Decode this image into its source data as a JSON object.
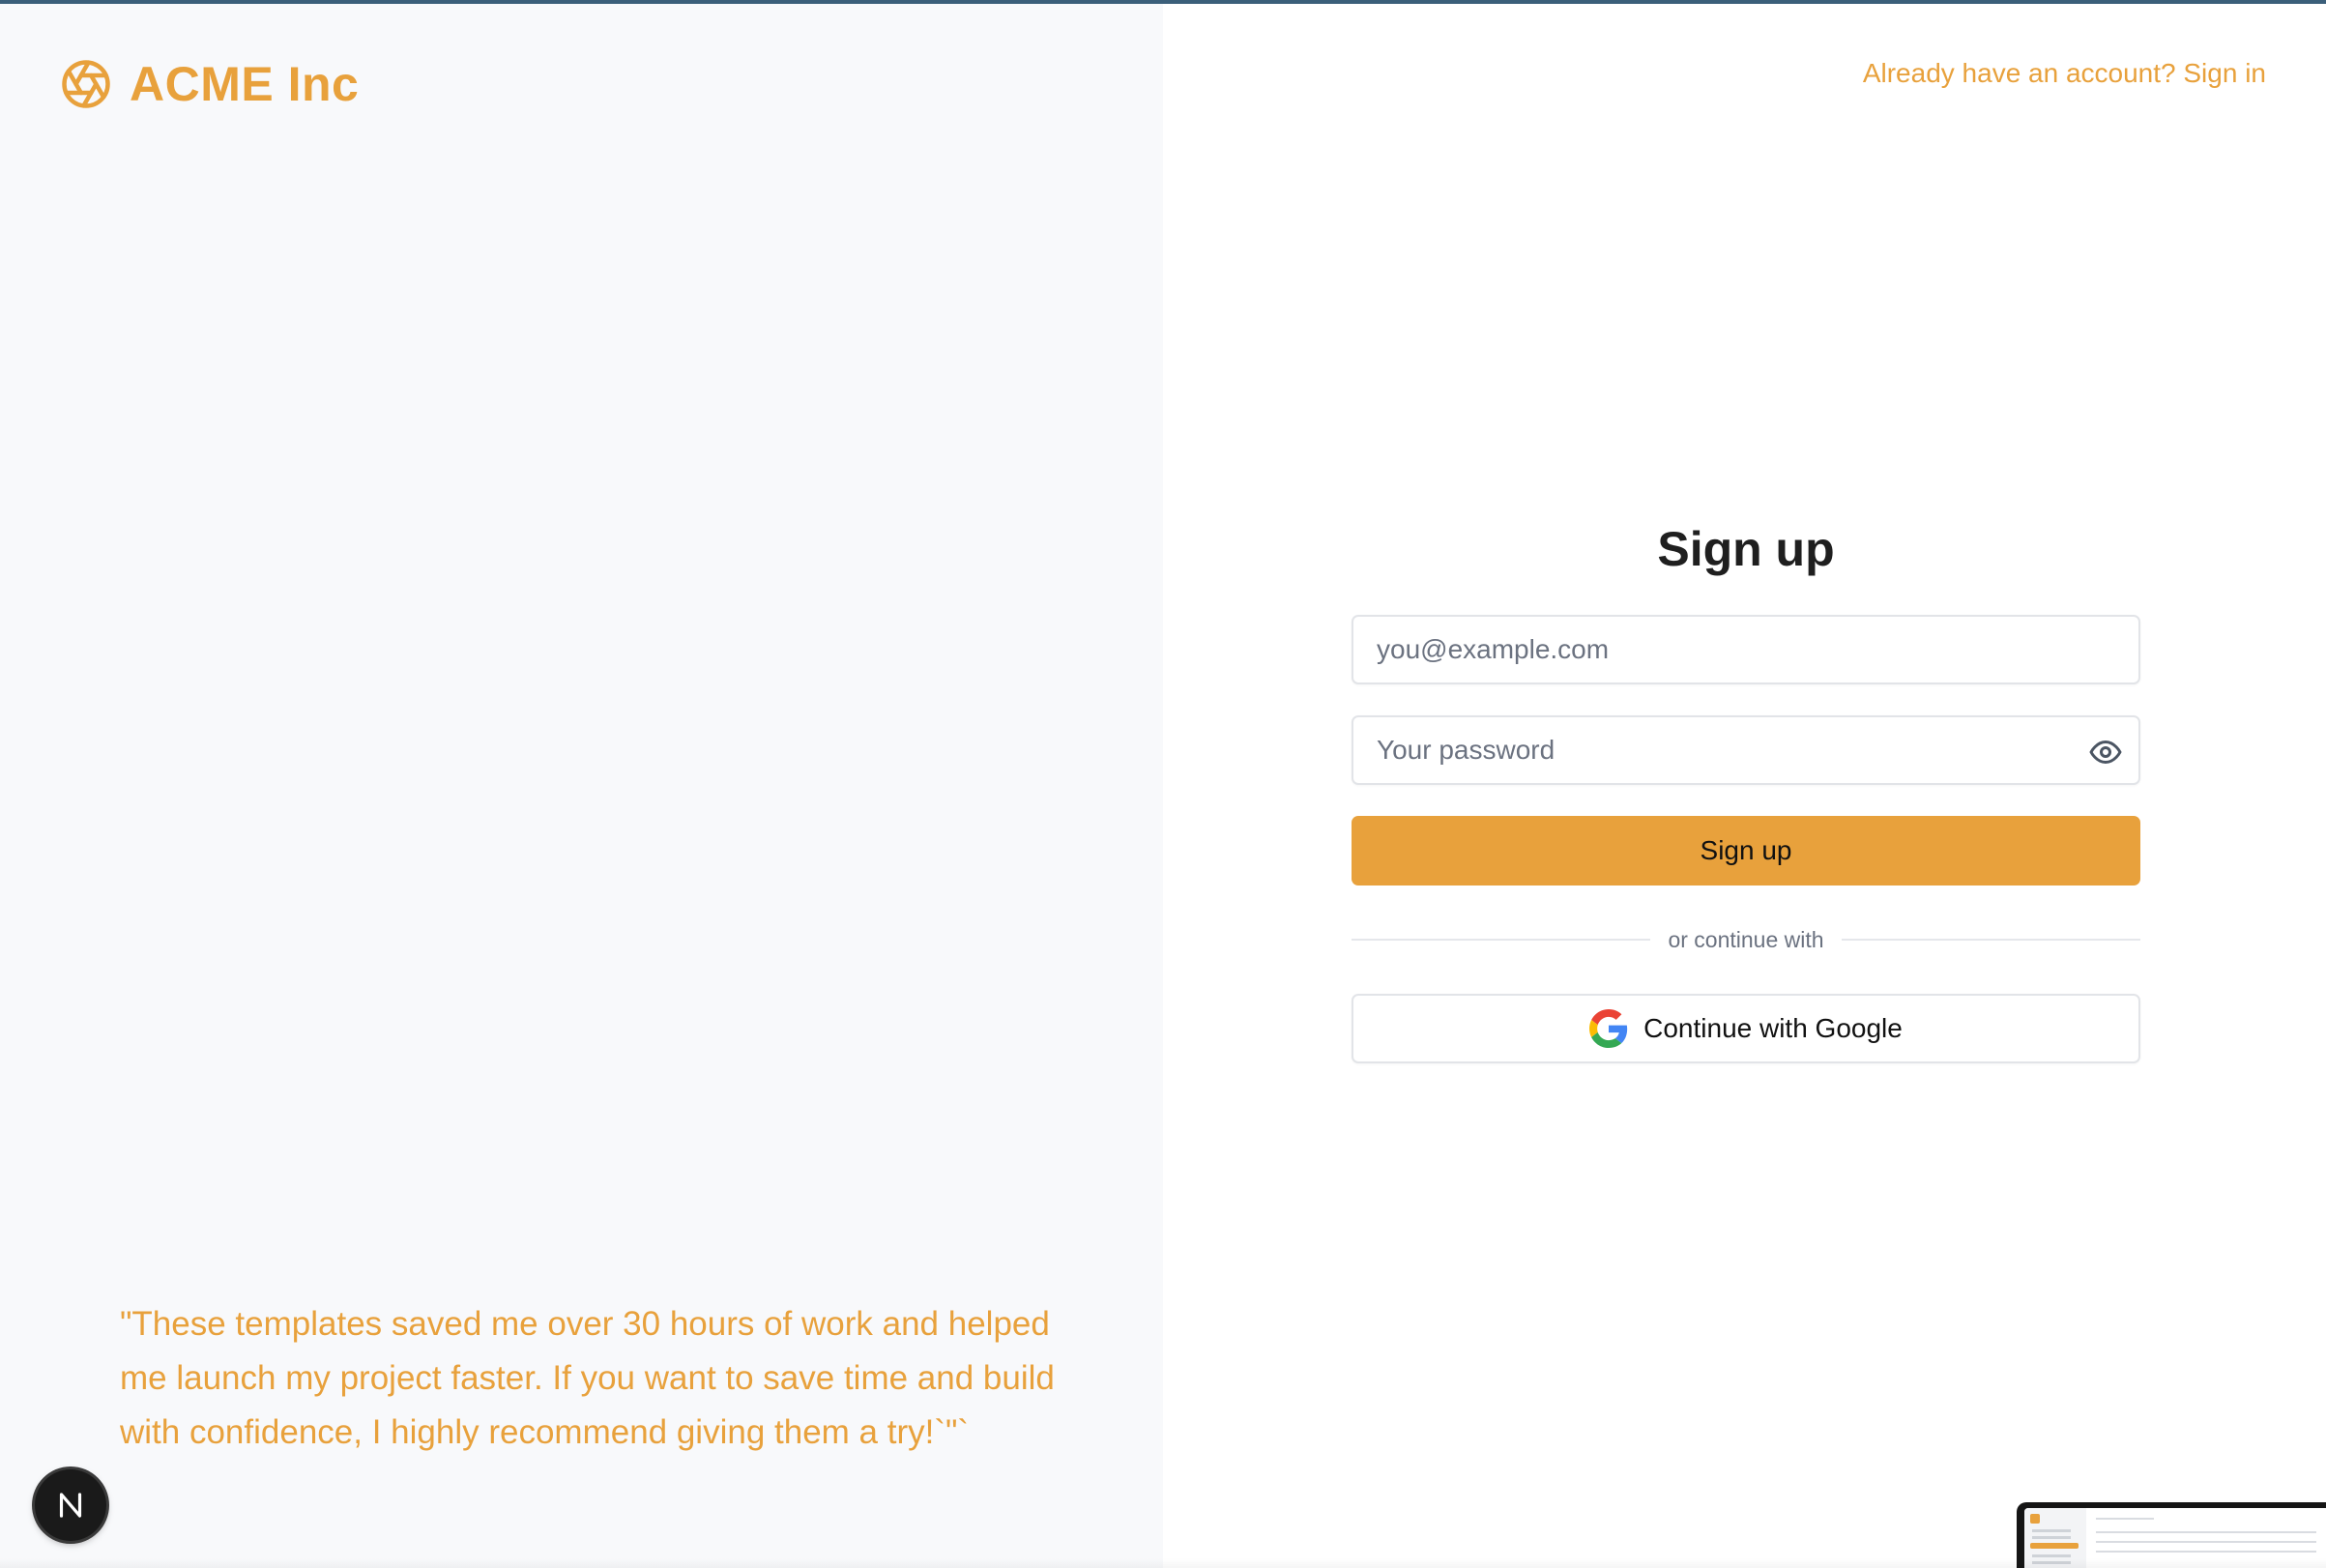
{
  "theme": {
    "accent": "#e8a13c",
    "top_line": "#3b5f7a",
    "left_panel_bg": "#f8f9fb"
  },
  "brand": {
    "name": "ACME Inc",
    "icon": "aperture-icon"
  },
  "header": {
    "signin_link": "Already have an account? Sign in"
  },
  "testimonial": {
    "quote": "\"These templates saved me over 30 hours of work and helped me launch my project faster. If you want to save time and build with confidence, I highly recommend giving them a try!`\"`"
  },
  "signup_form": {
    "title": "Sign up",
    "email_placeholder": "you@example.com",
    "password_placeholder": "Your password",
    "password_toggle_icon": "eye-icon",
    "submit_label": "Sign up",
    "divider_text": "or continue with",
    "google_label": "Continue with Google",
    "google_icon": "google-icon"
  },
  "dev_badge": {
    "letter": "N",
    "icon": "nextjs-icon"
  }
}
